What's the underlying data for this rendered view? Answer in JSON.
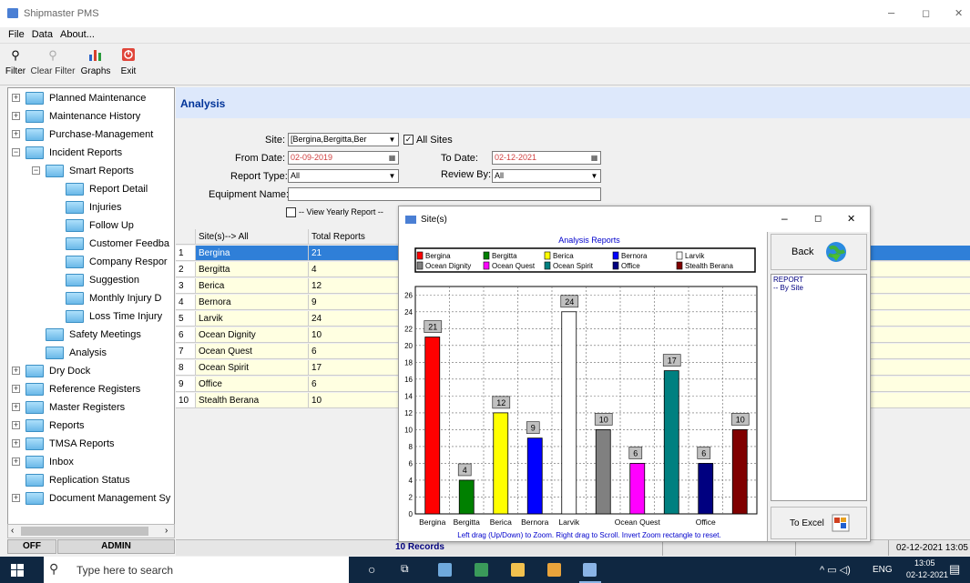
{
  "window": {
    "title": "Shipmaster PMS",
    "min": "–",
    "max": "◻",
    "close": "✕"
  },
  "menu": [
    "File",
    "Data",
    "About..."
  ],
  "toolbar": [
    {
      "label": "Filter",
      "icon": "binoculars-icon"
    },
    {
      "label": "Clear Filter",
      "icon": "binoculars-gray-icon"
    },
    {
      "label": "Graphs",
      "icon": "bar-chart-icon"
    },
    {
      "label": "Exit",
      "icon": "power-icon"
    }
  ],
  "tree": [
    {
      "label": "Planned Maintenance",
      "level": 0,
      "exp": "+"
    },
    {
      "label": "Maintenance History",
      "level": 0,
      "exp": "+"
    },
    {
      "label": "Purchase-Management",
      "level": 0,
      "exp": "+"
    },
    {
      "label": "Incident Reports",
      "level": 0,
      "exp": "-"
    },
    {
      "label": "Smart Reports",
      "level": 1,
      "exp": "-"
    },
    {
      "label": "Report Detail",
      "level": 2,
      "exp": ""
    },
    {
      "label": "Injuries",
      "level": 2,
      "exp": ""
    },
    {
      "label": "Follow Up",
      "level": 2,
      "exp": ""
    },
    {
      "label": "Customer Feedba",
      "level": 2,
      "exp": ""
    },
    {
      "label": "Company Respor",
      "level": 2,
      "exp": ""
    },
    {
      "label": "Suggestion",
      "level": 2,
      "exp": ""
    },
    {
      "label": "Monthly Injury D",
      "level": 2,
      "exp": ""
    },
    {
      "label": "Loss Time Injury",
      "level": 2,
      "exp": ""
    },
    {
      "label": "Safety Meetings",
      "level": 1,
      "exp": ""
    },
    {
      "label": "Analysis",
      "level": 1,
      "exp": ""
    },
    {
      "label": "Dry Dock",
      "level": 0,
      "exp": "+"
    },
    {
      "label": "Reference Registers",
      "level": 0,
      "exp": "+"
    },
    {
      "label": "Master Registers",
      "level": 0,
      "exp": "+"
    },
    {
      "label": "Reports",
      "level": 0,
      "exp": "+"
    },
    {
      "label": "TMSA Reports",
      "level": 0,
      "exp": "+"
    },
    {
      "label": "Inbox",
      "level": 0,
      "exp": "+"
    },
    {
      "label": "Replication Status",
      "level": 0,
      "exp": ""
    },
    {
      "label": "Document Management Sy",
      "level": 0,
      "exp": "+"
    }
  ],
  "status_left": {
    "state": "OFF",
    "user": "ADMIN"
  },
  "panel": {
    "title": "Analysis"
  },
  "form": {
    "site_label": "Site:",
    "site_value": "[Bergina,Bergitta,Ber",
    "all_sites": "All Sites",
    "from_label": "From Date:",
    "from_value": "02-09-2019",
    "to_label": "To Date:",
    "to_value": "02-12-2021",
    "report_type_label": "Report Type:",
    "report_type_value": "All",
    "review_by_label": "Review By:",
    "review_by_value": "All",
    "equipment_label": "Equipment Name:",
    "equipment_value": "",
    "yearly_label": "-- View Yearly Report --"
  },
  "grid": {
    "col_site": "Site(s)--> All",
    "col_total": "Total Reports",
    "rows": [
      {
        "n": "1",
        "site": "Bergina",
        "total": "21"
      },
      {
        "n": "2",
        "site": "Bergitta",
        "total": "4"
      },
      {
        "n": "3",
        "site": "Berica",
        "total": "12"
      },
      {
        "n": "4",
        "site": "Bernora",
        "total": "9"
      },
      {
        "n": "5",
        "site": "Larvik",
        "total": "24"
      },
      {
        "n": "6",
        "site": "Ocean Dignity",
        "total": "10"
      },
      {
        "n": "7",
        "site": "Ocean Quest",
        "total": "6"
      },
      {
        "n": "8",
        "site": "Ocean Spirit",
        "total": "17"
      },
      {
        "n": "9",
        "site": "Office",
        "total": "6"
      },
      {
        "n": "10",
        "site": "Stealth Berana",
        "total": "10"
      }
    ]
  },
  "statusbar": {
    "records": "10 Records",
    "datetime": "02-12-2021 13:05"
  },
  "dialog": {
    "title": "Site(s)",
    "back": "Back",
    "to_excel": "To Excel",
    "report_head": "REPORT",
    "report_item": "-- By Site",
    "footer_hint": "Left drag (Up/Down) to Zoom. Right drag to Scroll. Invert Zoom rectangle to reset."
  },
  "chart_data": {
    "type": "bar",
    "title": "Analysis Reports",
    "categories": [
      "Bergina",
      "Bergitta",
      "Berica",
      "Bernora",
      "Larvik",
      "Ocean Dignity",
      "Ocean Quest",
      "Ocean Spirit",
      "Office",
      "Stealth Berana"
    ],
    "x_tick_labels": [
      "Bergina",
      "Bergitta",
      "Berica",
      "Bernora",
      "Larvik",
      "",
      "Ocean Quest",
      "",
      "Office",
      ""
    ],
    "values": [
      21,
      4,
      12,
      9,
      24,
      10,
      6,
      17,
      6,
      10
    ],
    "colors": [
      "#ff0000",
      "#008000",
      "#ffff00",
      "#0000ff",
      "#ffffff",
      "#808080",
      "#ff00ff",
      "#008080",
      "#000080",
      "#800000"
    ],
    "ylim": [
      0,
      27
    ],
    "yticks": [
      0,
      2,
      4,
      6,
      8,
      10,
      12,
      14,
      16,
      18,
      20,
      22,
      24,
      26
    ],
    "grid": true,
    "legend": "top"
  },
  "taskbar": {
    "search": "Type here to search",
    "lang": "ENG",
    "time": "13:05",
    "date": "02-12-2021"
  }
}
